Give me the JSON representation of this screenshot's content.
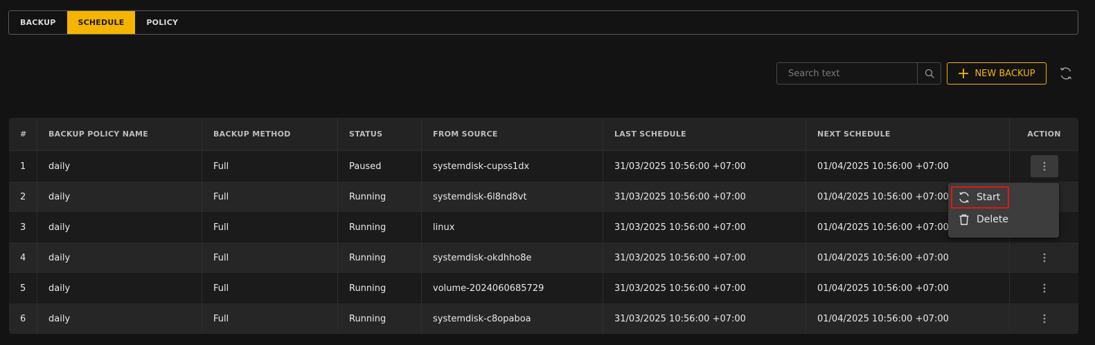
{
  "tabs": [
    {
      "label": "BACKUP",
      "active": false
    },
    {
      "label": "SCHEDULE",
      "active": true
    },
    {
      "label": "POLICY",
      "active": false
    }
  ],
  "toolbar": {
    "search_placeholder": "Search text",
    "new_backup_label": "NEW BACKUP"
  },
  "colors": {
    "accent": "#f5b400",
    "background": "#131313",
    "highlight_border": "#e01818"
  },
  "table": {
    "headers": [
      "#",
      "BACKUP POLICY NAME",
      "BACKUP METHOD",
      "STATUS",
      "FROM SOURCE",
      "LAST SCHEDULE",
      "NEXT SCHEDULE",
      "ACTION"
    ],
    "rows": [
      [
        "1",
        "daily",
        "Full",
        "Paused",
        "systemdisk-cupss1dx",
        "31/03/2025 10:56:00 +07:00",
        "01/04/2025 10:56:00 +07:00"
      ],
      [
        "2",
        "daily",
        "Full",
        "Running",
        "systemdisk-6l8nd8vt",
        "31/03/2025 10:56:00 +07:00",
        "01/04/2025 10:56:00 +07:00"
      ],
      [
        "3",
        "daily",
        "Full",
        "Running",
        "linux",
        "31/03/2025 10:56:00 +07:00",
        "01/04/2025 10:56:00 +07:00"
      ],
      [
        "4",
        "daily",
        "Full",
        "Running",
        "systemdisk-okdhho8e",
        "31/03/2025 10:56:00 +07:00",
        "01/04/2025 10:56:00 +07:00"
      ],
      [
        "5",
        "daily",
        "Full",
        "Running",
        "volume-2024060685729",
        "31/03/2025 10:56:00 +07:00",
        "01/04/2025 10:56:00 +07:00"
      ],
      [
        "6",
        "daily",
        "Full",
        "Running",
        "systemdisk-c8opaboa",
        "31/03/2025 10:56:00 +07:00",
        "01/04/2025 10:56:00 +07:00"
      ]
    ]
  },
  "action_menu": {
    "items": [
      {
        "label": "Start",
        "icon": "sync-icon"
      },
      {
        "label": "Delete",
        "icon": "trash-icon"
      }
    ]
  }
}
